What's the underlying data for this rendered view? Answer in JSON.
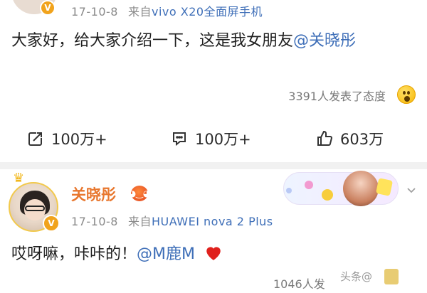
{
  "post1": {
    "verified_badge": "V",
    "timestamp": "17-10-8",
    "source_prefix": "来自",
    "source_device": "vivo X20全面屏手机",
    "text_before_mention": "大家好，给大家介绍一下，这是我女朋友",
    "mention": "@关晓彤",
    "reactions_text": "3391人发表了态度",
    "reaction_emoji": "wow-emoji",
    "actions": {
      "repost_count": "100万+",
      "comment_count": "100万+",
      "like_count": "603万"
    }
  },
  "post2": {
    "verified_badge": "V",
    "username": "关晓彤",
    "timestamp": "17-10-8",
    "source_prefix": "来自",
    "source_device": "HUAWEI nova 2 Plus",
    "text_before_mention": "哎呀嘛，咔咔的！",
    "mention": "@M鹿M",
    "reactions_text": "1046人发",
    "watermark": "头条@"
  },
  "colors": {
    "link": "#3f6fb8",
    "username": "#e8772e",
    "badge": "#f1a31c",
    "heart": "#e0211d"
  }
}
